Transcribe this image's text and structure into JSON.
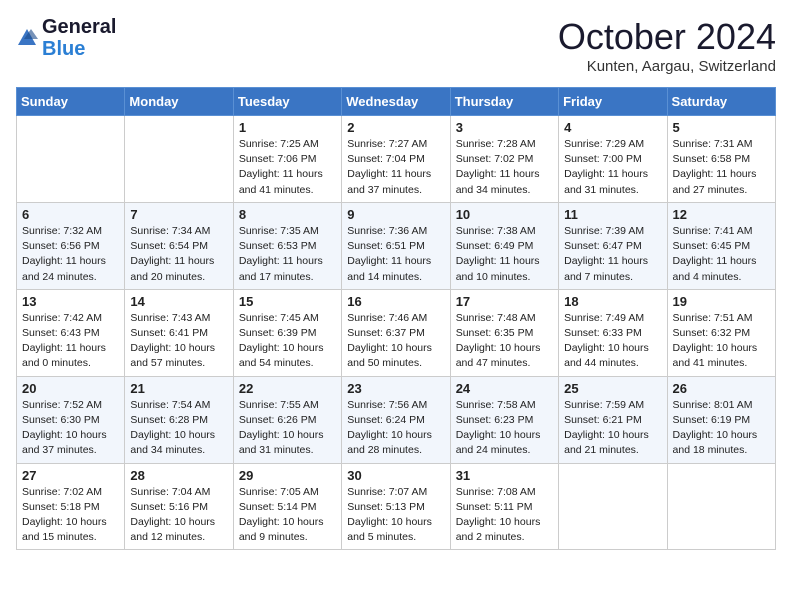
{
  "header": {
    "logo_general": "General",
    "logo_blue": "Blue",
    "month_title": "October 2024",
    "location": "Kunten, Aargau, Switzerland"
  },
  "weekdays": [
    "Sunday",
    "Monday",
    "Tuesday",
    "Wednesday",
    "Thursday",
    "Friday",
    "Saturday"
  ],
  "weeks": [
    [
      {
        "day": "",
        "sunrise": "",
        "sunset": "",
        "daylight": ""
      },
      {
        "day": "",
        "sunrise": "",
        "sunset": "",
        "daylight": ""
      },
      {
        "day": "1",
        "sunrise": "Sunrise: 7:25 AM",
        "sunset": "Sunset: 7:06 PM",
        "daylight": "Daylight: 11 hours and 41 minutes."
      },
      {
        "day": "2",
        "sunrise": "Sunrise: 7:27 AM",
        "sunset": "Sunset: 7:04 PM",
        "daylight": "Daylight: 11 hours and 37 minutes."
      },
      {
        "day": "3",
        "sunrise": "Sunrise: 7:28 AM",
        "sunset": "Sunset: 7:02 PM",
        "daylight": "Daylight: 11 hours and 34 minutes."
      },
      {
        "day": "4",
        "sunrise": "Sunrise: 7:29 AM",
        "sunset": "Sunset: 7:00 PM",
        "daylight": "Daylight: 11 hours and 31 minutes."
      },
      {
        "day": "5",
        "sunrise": "Sunrise: 7:31 AM",
        "sunset": "Sunset: 6:58 PM",
        "daylight": "Daylight: 11 hours and 27 minutes."
      }
    ],
    [
      {
        "day": "6",
        "sunrise": "Sunrise: 7:32 AM",
        "sunset": "Sunset: 6:56 PM",
        "daylight": "Daylight: 11 hours and 24 minutes."
      },
      {
        "day": "7",
        "sunrise": "Sunrise: 7:34 AM",
        "sunset": "Sunset: 6:54 PM",
        "daylight": "Daylight: 11 hours and 20 minutes."
      },
      {
        "day": "8",
        "sunrise": "Sunrise: 7:35 AM",
        "sunset": "Sunset: 6:53 PM",
        "daylight": "Daylight: 11 hours and 17 minutes."
      },
      {
        "day": "9",
        "sunrise": "Sunrise: 7:36 AM",
        "sunset": "Sunset: 6:51 PM",
        "daylight": "Daylight: 11 hours and 14 minutes."
      },
      {
        "day": "10",
        "sunrise": "Sunrise: 7:38 AM",
        "sunset": "Sunset: 6:49 PM",
        "daylight": "Daylight: 11 hours and 10 minutes."
      },
      {
        "day": "11",
        "sunrise": "Sunrise: 7:39 AM",
        "sunset": "Sunset: 6:47 PM",
        "daylight": "Daylight: 11 hours and 7 minutes."
      },
      {
        "day": "12",
        "sunrise": "Sunrise: 7:41 AM",
        "sunset": "Sunset: 6:45 PM",
        "daylight": "Daylight: 11 hours and 4 minutes."
      }
    ],
    [
      {
        "day": "13",
        "sunrise": "Sunrise: 7:42 AM",
        "sunset": "Sunset: 6:43 PM",
        "daylight": "Daylight: 11 hours and 0 minutes."
      },
      {
        "day": "14",
        "sunrise": "Sunrise: 7:43 AM",
        "sunset": "Sunset: 6:41 PM",
        "daylight": "Daylight: 10 hours and 57 minutes."
      },
      {
        "day": "15",
        "sunrise": "Sunrise: 7:45 AM",
        "sunset": "Sunset: 6:39 PM",
        "daylight": "Daylight: 10 hours and 54 minutes."
      },
      {
        "day": "16",
        "sunrise": "Sunrise: 7:46 AM",
        "sunset": "Sunset: 6:37 PM",
        "daylight": "Daylight: 10 hours and 50 minutes."
      },
      {
        "day": "17",
        "sunrise": "Sunrise: 7:48 AM",
        "sunset": "Sunset: 6:35 PM",
        "daylight": "Daylight: 10 hours and 47 minutes."
      },
      {
        "day": "18",
        "sunrise": "Sunrise: 7:49 AM",
        "sunset": "Sunset: 6:33 PM",
        "daylight": "Daylight: 10 hours and 44 minutes."
      },
      {
        "day": "19",
        "sunrise": "Sunrise: 7:51 AM",
        "sunset": "Sunset: 6:32 PM",
        "daylight": "Daylight: 10 hours and 41 minutes."
      }
    ],
    [
      {
        "day": "20",
        "sunrise": "Sunrise: 7:52 AM",
        "sunset": "Sunset: 6:30 PM",
        "daylight": "Daylight: 10 hours and 37 minutes."
      },
      {
        "day": "21",
        "sunrise": "Sunrise: 7:54 AM",
        "sunset": "Sunset: 6:28 PM",
        "daylight": "Daylight: 10 hours and 34 minutes."
      },
      {
        "day": "22",
        "sunrise": "Sunrise: 7:55 AM",
        "sunset": "Sunset: 6:26 PM",
        "daylight": "Daylight: 10 hours and 31 minutes."
      },
      {
        "day": "23",
        "sunrise": "Sunrise: 7:56 AM",
        "sunset": "Sunset: 6:24 PM",
        "daylight": "Daylight: 10 hours and 28 minutes."
      },
      {
        "day": "24",
        "sunrise": "Sunrise: 7:58 AM",
        "sunset": "Sunset: 6:23 PM",
        "daylight": "Daylight: 10 hours and 24 minutes."
      },
      {
        "day": "25",
        "sunrise": "Sunrise: 7:59 AM",
        "sunset": "Sunset: 6:21 PM",
        "daylight": "Daylight: 10 hours and 21 minutes."
      },
      {
        "day": "26",
        "sunrise": "Sunrise: 8:01 AM",
        "sunset": "Sunset: 6:19 PM",
        "daylight": "Daylight: 10 hours and 18 minutes."
      }
    ],
    [
      {
        "day": "27",
        "sunrise": "Sunrise: 7:02 AM",
        "sunset": "Sunset: 5:18 PM",
        "daylight": "Daylight: 10 hours and 15 minutes."
      },
      {
        "day": "28",
        "sunrise": "Sunrise: 7:04 AM",
        "sunset": "Sunset: 5:16 PM",
        "daylight": "Daylight: 10 hours and 12 minutes."
      },
      {
        "day": "29",
        "sunrise": "Sunrise: 7:05 AM",
        "sunset": "Sunset: 5:14 PM",
        "daylight": "Daylight: 10 hours and 9 minutes."
      },
      {
        "day": "30",
        "sunrise": "Sunrise: 7:07 AM",
        "sunset": "Sunset: 5:13 PM",
        "daylight": "Daylight: 10 hours and 5 minutes."
      },
      {
        "day": "31",
        "sunrise": "Sunrise: 7:08 AM",
        "sunset": "Sunset: 5:11 PM",
        "daylight": "Daylight: 10 hours and 2 minutes."
      },
      {
        "day": "",
        "sunrise": "",
        "sunset": "",
        "daylight": ""
      },
      {
        "day": "",
        "sunrise": "",
        "sunset": "",
        "daylight": ""
      }
    ]
  ]
}
